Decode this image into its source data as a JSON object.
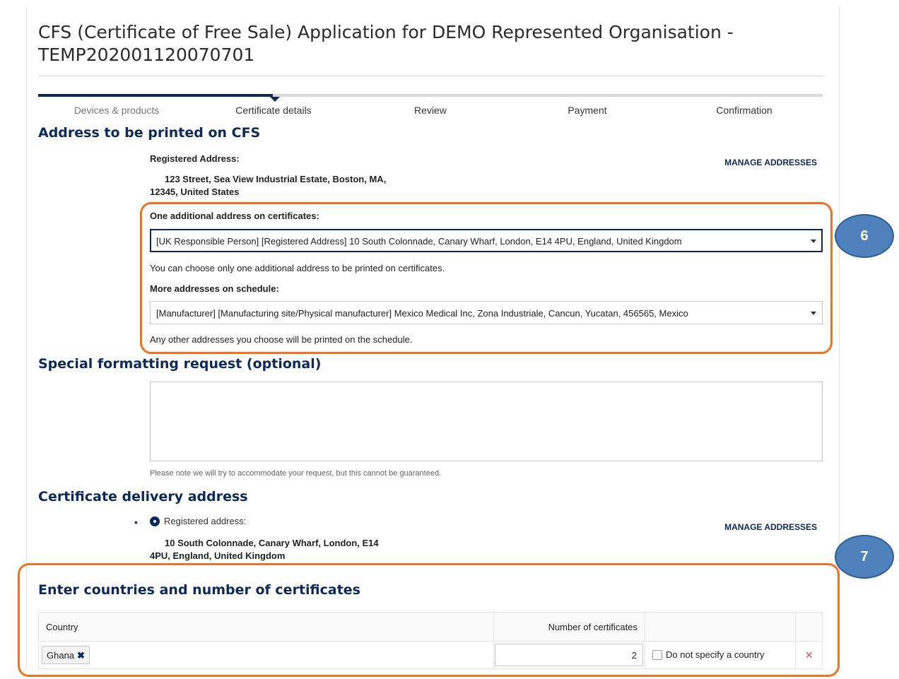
{
  "header": {
    "title": "CFS (Certificate of Free Sale) Application for DEMO Represented Organisation - TEMP202001120070701"
  },
  "progress": {
    "steps": [
      "Devices & products",
      "Certificate details",
      "Review",
      "Payment",
      "Confirmation"
    ],
    "current_step": "Certificate details"
  },
  "address_section": {
    "heading": "Address to be printed on CFS",
    "registered_label": "Registered Address:",
    "registered_line1": "123 Street, Sea View Industrial Estate,  Boston, MA,",
    "registered_line2": "12345, United States",
    "manage_link": "MANAGE ADDRESSES",
    "additional_label": "One additional address on certificates:",
    "additional_value": "[UK Responsible Person] [Registered Address] 10 South Colonnade, Canary Wharf, London, E14 4PU, England, United Kingdom",
    "additional_hint": "You can choose only one additional address to be printed on certificates.",
    "schedule_label": "More addresses on schedule:",
    "schedule_value": "[Manufacturer] [Manufacturing site/Physical manufacturer] Mexico Medical Inc, Zona Industriale, Cancun, Yucatan, 456565, Mexico",
    "schedule_hint": "Any other addresses you choose will be printed on the schedule."
  },
  "formatting_section": {
    "heading": "Special formatting request (optional)",
    "textarea_value": "",
    "note": "Please note we will try to accommodate your request, but this cannot be guaranteed."
  },
  "delivery_section": {
    "heading": "Certificate delivery address",
    "radio_label": "Registered address:",
    "line1": "10 South Colonnade, Canary Wharf,  London, E14",
    "line2": "4PU, England, United Kingdom",
    "manage_link": "MANAGE ADDRESSES"
  },
  "countries_section": {
    "heading": "Enter countries and number of certificates",
    "columns": [
      "Country",
      "Number of certificates"
    ],
    "rows": [
      {
        "country": "Ghana",
        "remove_glyph": "✖",
        "number": "2",
        "do_not_specify_label": "Do not specify a country",
        "do_not_specify_checked": false,
        "delete_glyph": "✕"
      }
    ]
  },
  "annotations": {
    "callout_a": "6",
    "callout_b": "7",
    "box_color": "#f27121",
    "circle_color": "#4f81bd"
  },
  "colors": {
    "brand_navy": "#0b2a5b",
    "delete_red": "#d9534f"
  }
}
